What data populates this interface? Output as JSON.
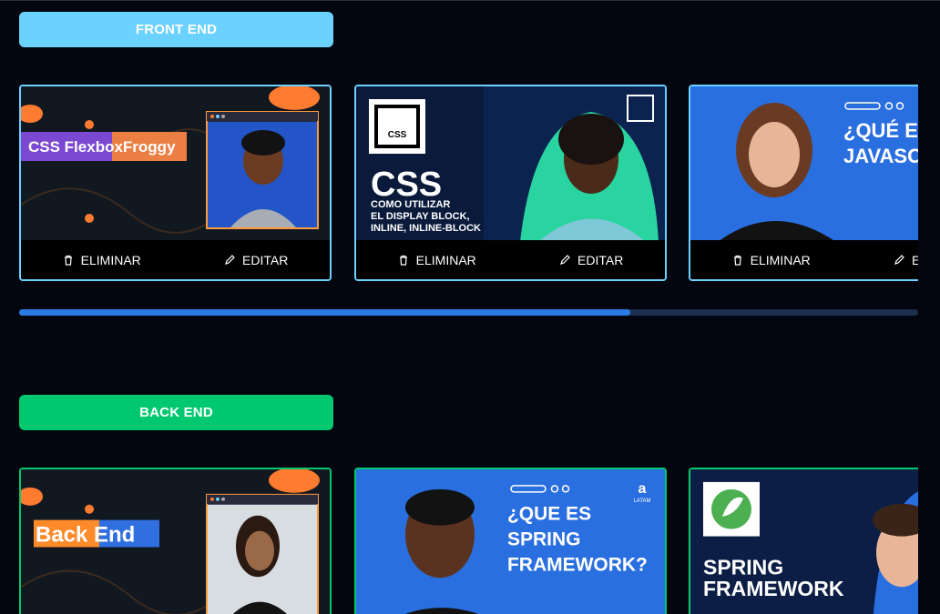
{
  "categories": {
    "front": {
      "label": "FRONT END",
      "color": "#6bd1ff",
      "scroll_fraction": 0.68
    },
    "back": {
      "label": "BACK END",
      "color": "#00c86f"
    }
  },
  "actions": {
    "delete_label": "ELIMINAR",
    "edit_label": "EDITAR",
    "delete_icon": "trash-icon",
    "edit_icon": "pencil-icon"
  },
  "front_videos": [
    {
      "title_lines": [
        "CSS FlexboxFroggy"
      ]
    },
    {
      "title_lines": [
        "CSS",
        "COMO UTILIZAR",
        "EL DISPLAY BLOCK,",
        "INLINE, INLINE-BLOCK"
      ],
      "badge": "CSS"
    },
    {
      "title_lines": [
        "¿QUÉ ES",
        "JAVASC"
      ]
    }
  ],
  "back_videos": [
    {
      "title_lines": [
        "Back End"
      ]
    },
    {
      "title_lines": [
        "¿QUE ES",
        "SPRING",
        "FRAMEWORK?"
      ],
      "brand": "LATAM"
    },
    {
      "title_lines": [
        "SPRING",
        "FRAMEWORK"
      ]
    }
  ]
}
